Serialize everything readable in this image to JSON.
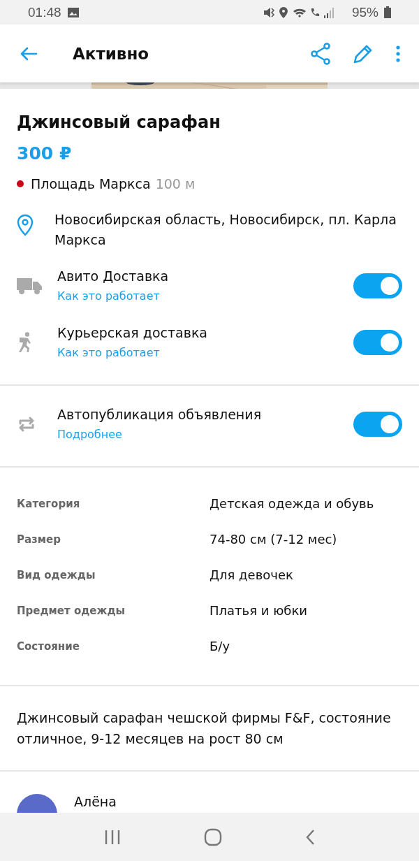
{
  "status_bar": {
    "time": "01:48",
    "battery": "95%"
  },
  "toolbar": {
    "title": "Активно"
  },
  "listing": {
    "title": "Джинсовый сарафан",
    "price": "300 ₽",
    "metro": {
      "station": "Площадь Маркса",
      "distance": "100 м",
      "color": "#d0021b"
    },
    "address": "Новосибирская область, Новосибирск, пл. Карла Маркса"
  },
  "delivery": [
    {
      "kind": "truck",
      "label": "Авито Доставка",
      "link": "Как это работает",
      "on": true
    },
    {
      "kind": "courier",
      "label": "Курьерская доставка",
      "link": "Как это работает",
      "on": true
    }
  ],
  "autopublish": {
    "label": "Автопубликация объявления",
    "link": "Подробнее",
    "on": true
  },
  "params": [
    {
      "name": "Категория",
      "value": "Детская одежда и обувь"
    },
    {
      "name": "Размер",
      "value": "74-80 см (7-12 мес)"
    },
    {
      "name": "Вид одежды",
      "value": "Для девочек"
    },
    {
      "name": "Предмет одежды",
      "value": "Платья и юбки"
    },
    {
      "name": "Состояние",
      "value": "Б/у"
    }
  ],
  "description": "Джинсовый сарафан чешской фирмы F&F, состояние отличное, 9-12 месяцев на рост 80 см",
  "seller": {
    "name": "Алёна"
  }
}
